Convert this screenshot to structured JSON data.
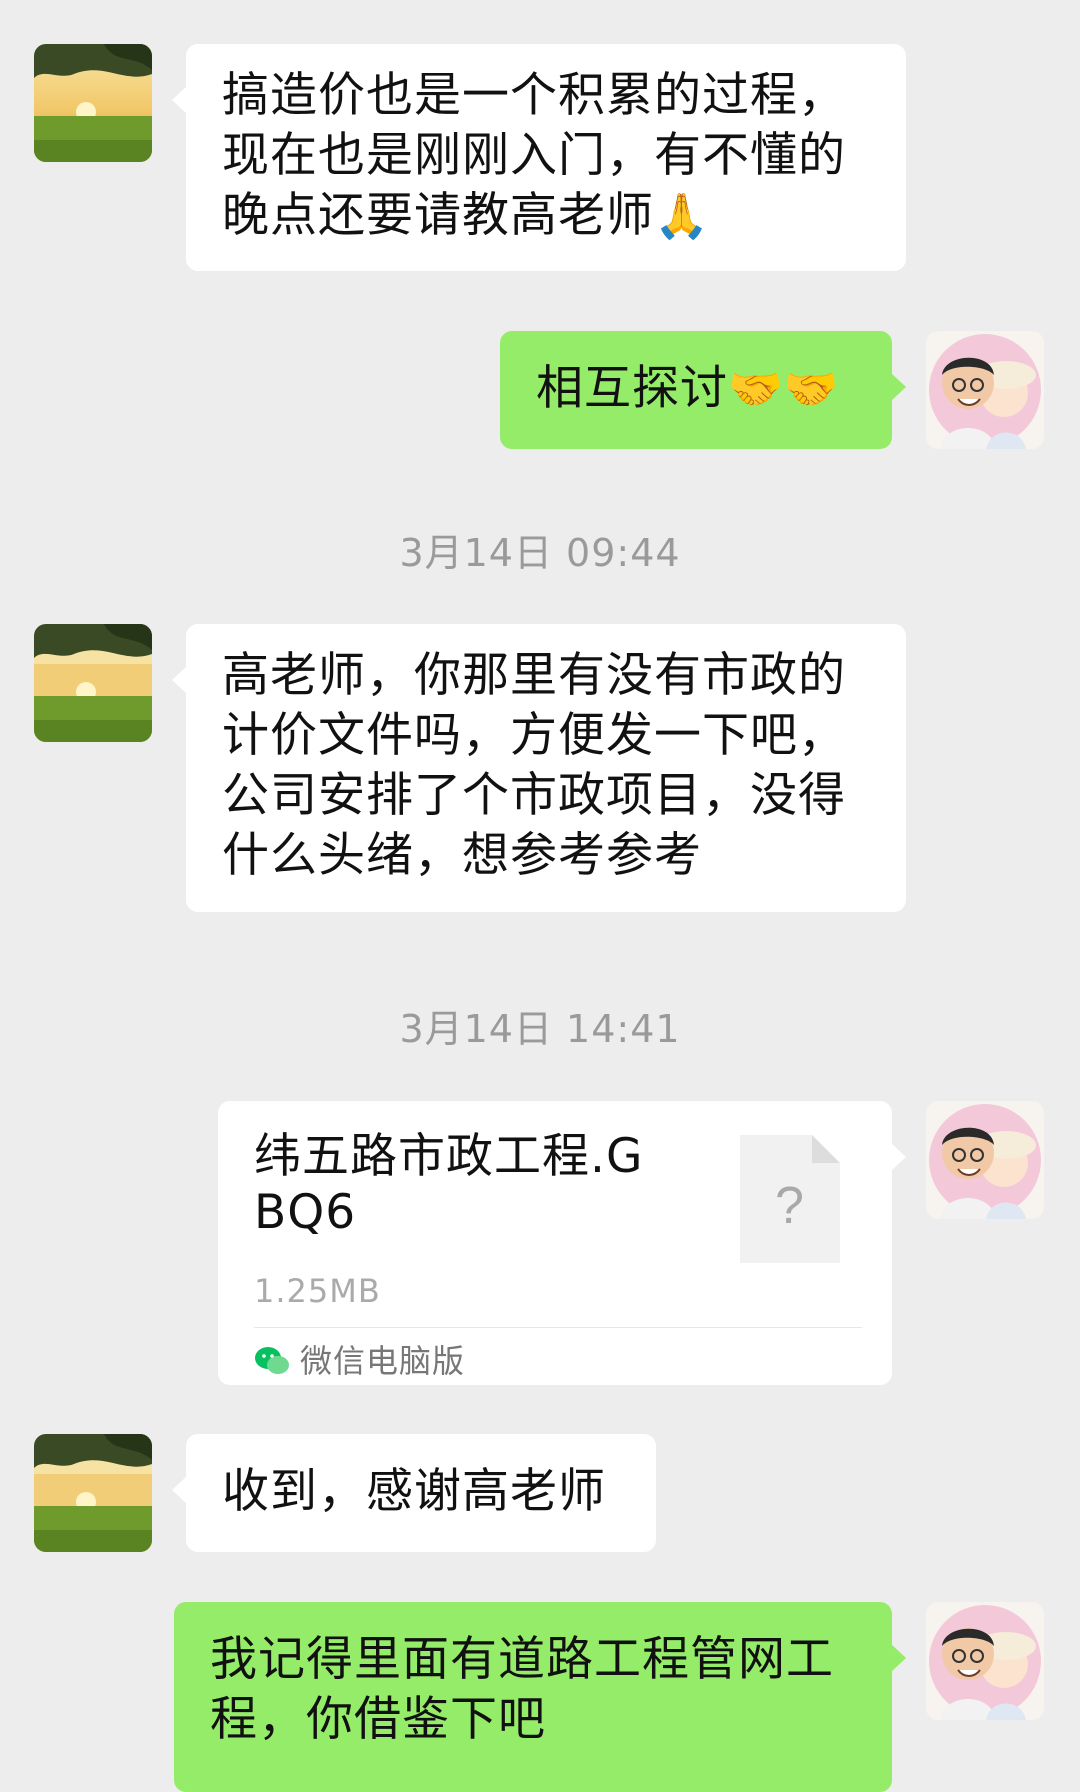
{
  "messages": [
    {
      "text": "搞造价也是一个积累的过程，现在也是刚刚入门，有不懂的晚点还要请教高老师",
      "emoji": "🙏"
    },
    {
      "text": "相互探讨",
      "emoji": "🤝🤝"
    },
    {
      "text": "高老师，你那里有没有市政的计价文件吗，方便发一下吧，公司安排了个市政项目，没得什么头绪，想参考参考"
    },
    {
      "file_name": "纬五路市政工程.GBQ6",
      "file_size": "1.25MB",
      "file_source": "微信电脑版",
      "file_icon_glyph": "?"
    },
    {
      "text": "收到，感谢高老师"
    },
    {
      "text": "我记得里面有道路工程管网工程，你借鉴下吧"
    }
  ],
  "timestamps": [
    "3月14日 09:44",
    "3月14日 14:41"
  ],
  "colors": {
    "background": "#ededed",
    "incoming_bubble": "#ffffff",
    "outgoing_bubble": "#95ec69",
    "timestamp_text": "#9a9a9a",
    "wechat_green": "#07c160"
  },
  "icons": {
    "contact_avatar": "landscape-avatar-icon",
    "self_avatar": "caricature-avatar-icon",
    "file_type": "unknown-file-icon",
    "source_app": "wechat-icon"
  }
}
